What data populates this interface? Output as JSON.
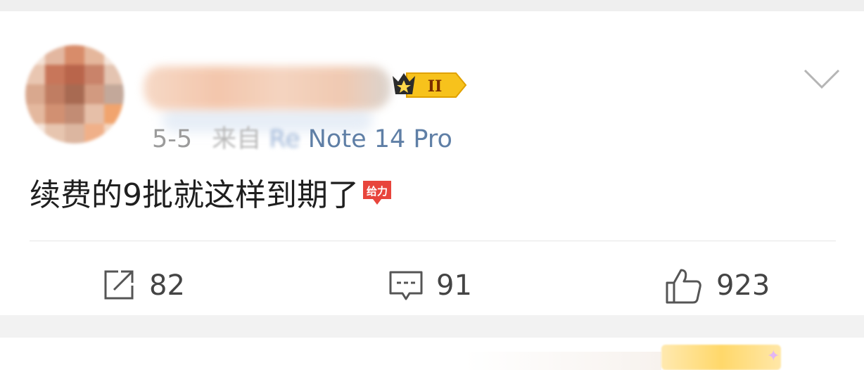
{
  "post": {
    "date": "5-5",
    "source_prefix": "来自",
    "device_hidden": "Re",
    "device": "Note 14 Pro",
    "text": "续费的9批就这样到期了",
    "emoji_label": "给力",
    "badge_level": "II"
  },
  "actions": {
    "repost_count": "82",
    "comment_count": "91",
    "like_count": "923"
  },
  "icons": {
    "repost": "repost-icon",
    "comment": "comment-icon",
    "like": "thumbs-up-icon",
    "more": "chevron-down-icon"
  },
  "colors": {
    "device_link": "#5f7fa6",
    "badge_gold": "#f5b400",
    "emoji_red": "#e8453c"
  }
}
